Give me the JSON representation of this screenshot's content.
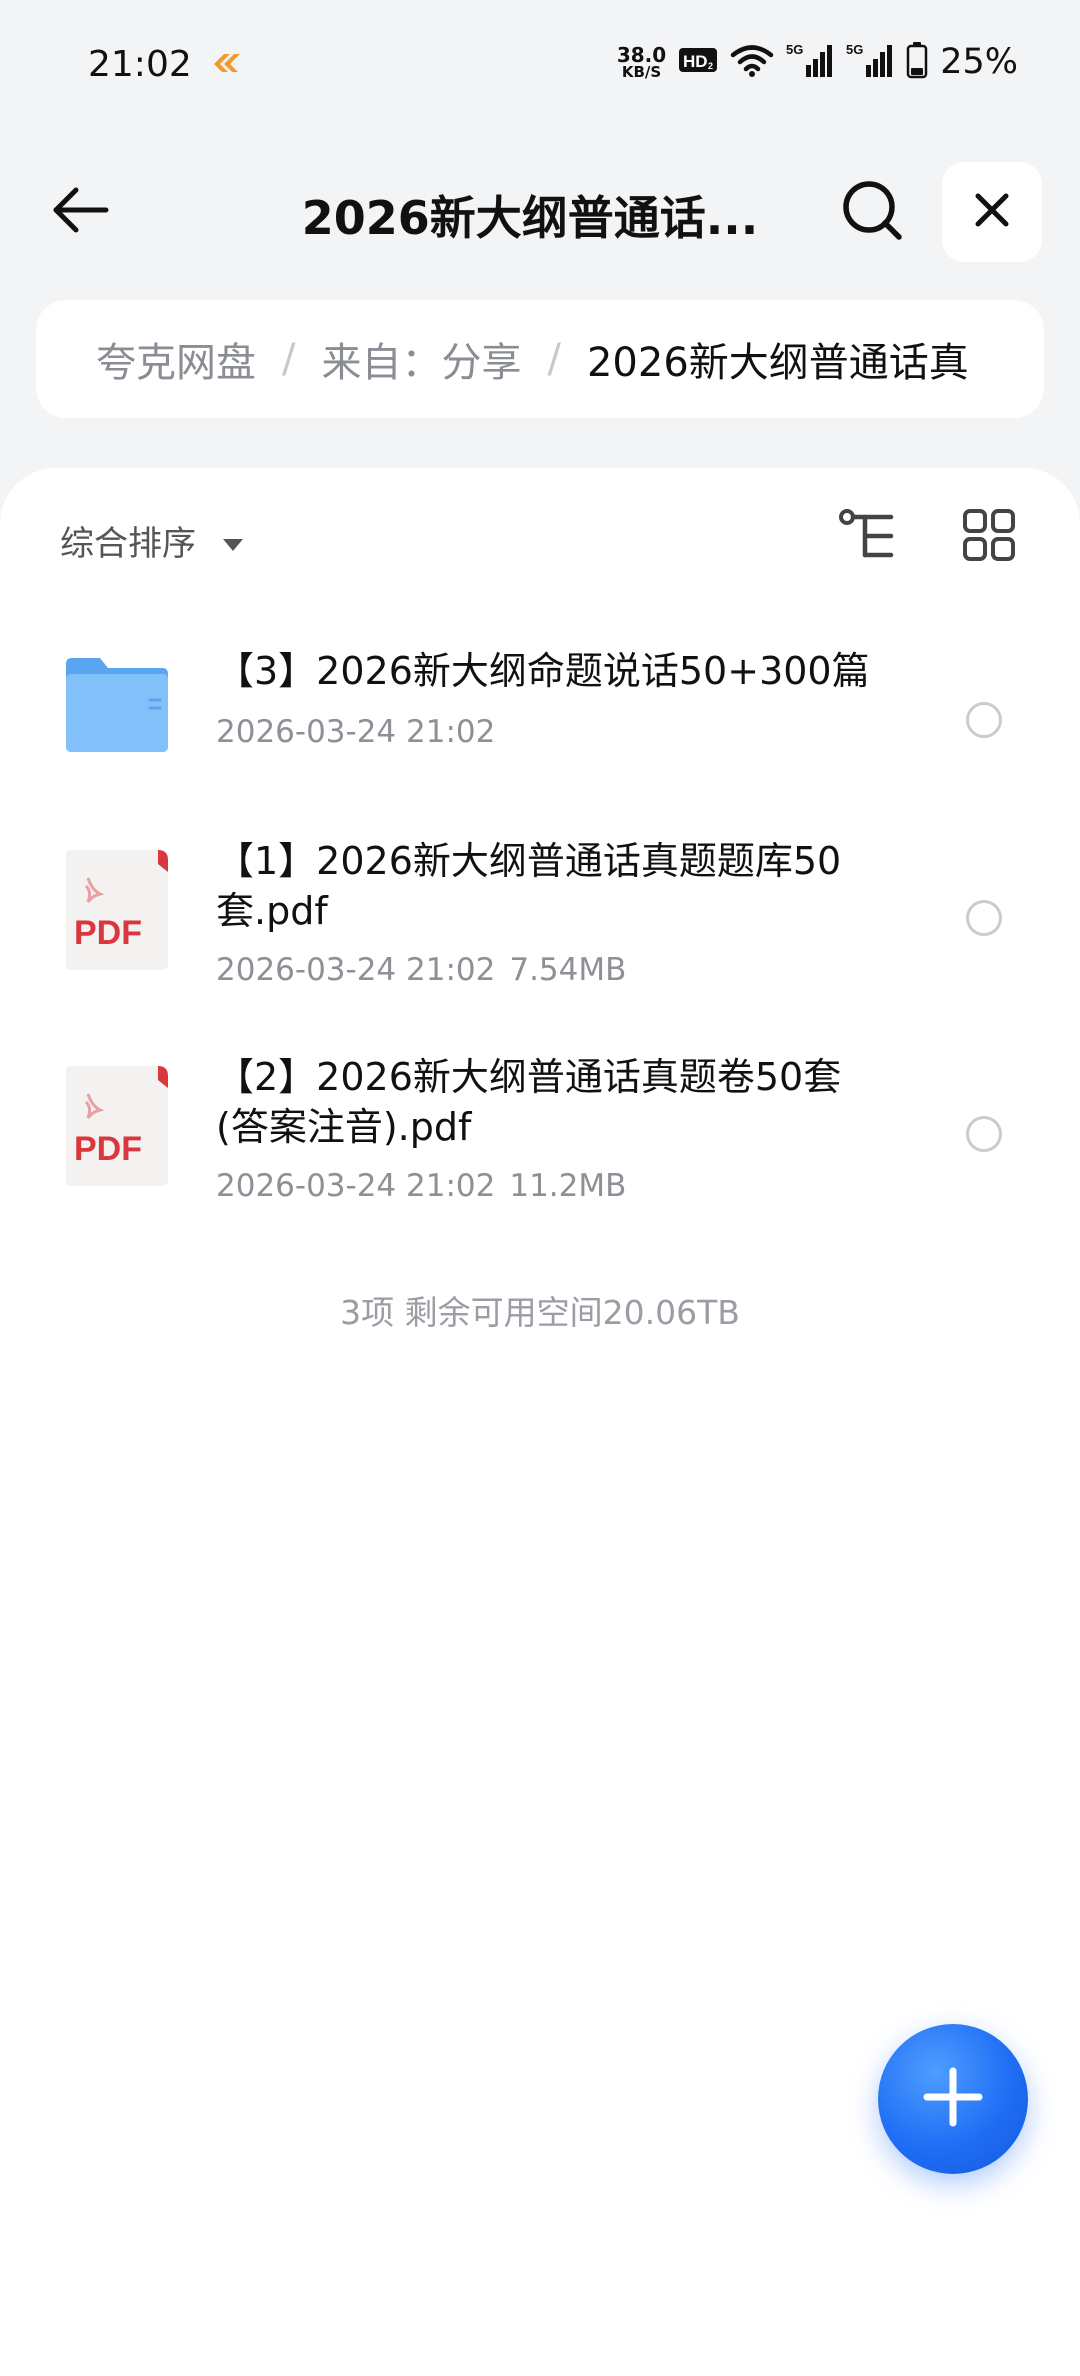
{
  "status_bar": {
    "time": "21:02",
    "net_speed_value": "38.0",
    "net_speed_unit": "KB/S",
    "hd_badge": "HD",
    "signal_1": "5G",
    "signal_2": "5G",
    "battery": "25%"
  },
  "header": {
    "title": "2026新大纲普通话...",
    "icons": [
      "back-arrow-icon",
      "search-icon",
      "close-icon"
    ]
  },
  "breadcrumb": {
    "items": [
      "夸克网盘",
      "来自：分享",
      "2026新大纲普通话真"
    ],
    "separator": "/"
  },
  "toolbar": {
    "sort_label": "综合排序",
    "icons": [
      "caret-down-icon",
      "tree-view-icon",
      "grid-view-icon"
    ]
  },
  "files": [
    {
      "type": "folder",
      "icon": "folder-icon",
      "name": "【3】2026新大纲命题说话50+300篇",
      "date": "2026-03-24 21:02",
      "size": ""
    },
    {
      "type": "pdf",
      "icon": "pdf-icon",
      "icon_label": "PDF",
      "name": "【1】2026新大纲普通话真题题库50套.pdf",
      "date": "2026-03-24 21:02",
      "size": "7.54MB"
    },
    {
      "type": "pdf",
      "icon": "pdf-icon",
      "icon_label": "PDF",
      "name": "【2】2026新大纲普通话真题卷50套(答案注音).pdf",
      "date": "2026-03-24 21:02",
      "size": "11.2MB"
    }
  ],
  "footer": {
    "summary": "3项 剩余可用空间20.06TB"
  },
  "fab": {
    "icon": "plus-icon"
  },
  "colors": {
    "accent": "#1f6ef5",
    "folder": "#6fb2f5",
    "pdf_red": "#d9363e",
    "background": "#f3f4f6"
  }
}
